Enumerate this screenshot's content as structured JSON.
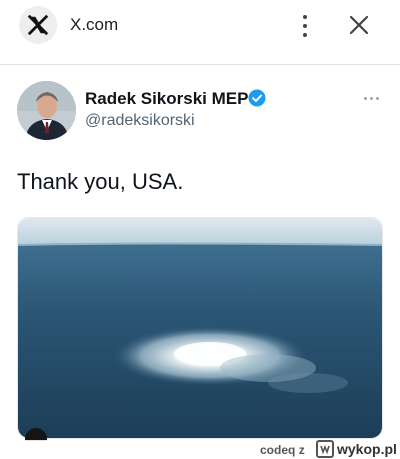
{
  "browser": {
    "site_name": "X.com",
    "icons": [
      "x-logo-icon",
      "kebab-menu-icon",
      "close-icon"
    ]
  },
  "tweet": {
    "author_name": "Radek Sikorski MEP",
    "handle": "@radeksikorski",
    "text": "Thank you, USA.",
    "verified_color": "#1d9bf0",
    "image_alt_icon": "sea-gas-leak-photo"
  },
  "watermark": {
    "user": "codeq",
    "connector": "z",
    "site": "wykop.pl"
  }
}
